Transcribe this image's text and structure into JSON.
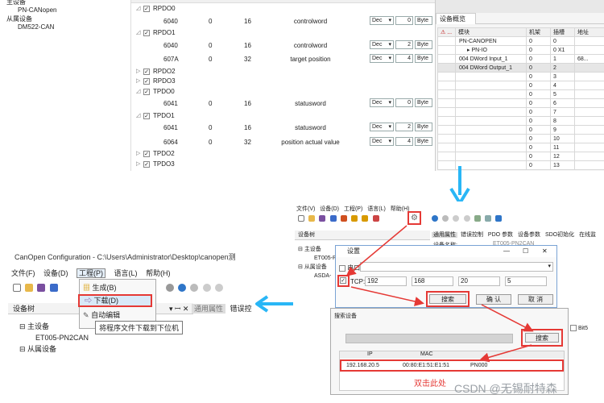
{
  "top_left_tree": {
    "items": [
      "主设备",
      "PN-CANopen",
      "从属设备",
      "DM522-CAN"
    ]
  },
  "pdo_panel": {
    "rows": [
      {
        "type": "group",
        "label": "RPDO0",
        "checked": true,
        "expand": "▲"
      },
      {
        "type": "row",
        "index": "6040",
        "sub": "0",
        "bits": "16",
        "name": "controlword",
        "fmt": "Dec",
        "val": "0",
        "unit": "Byte"
      },
      {
        "type": "group",
        "label": "RPDO1",
        "checked": true,
        "expand": "▲"
      },
      {
        "type": "row",
        "index": "6040",
        "sub": "0",
        "bits": "16",
        "name": "controlword",
        "fmt": "Dec",
        "val": "2",
        "unit": "Byte"
      },
      {
        "type": "row",
        "index": "607A",
        "sub": "0",
        "bits": "32",
        "name": "target position",
        "fmt": "Dec",
        "val": "4",
        "unit": "Byte"
      },
      {
        "type": "group",
        "label": "RPDO2",
        "checked": true,
        "expand": "▷"
      },
      {
        "type": "group",
        "label": "RPDO3",
        "checked": true,
        "expand": "▷"
      },
      {
        "type": "group",
        "label": "TPDO0",
        "checked": true,
        "expand": "▲"
      },
      {
        "type": "row",
        "index": "6041",
        "sub": "0",
        "bits": "16",
        "name": "statusword",
        "fmt": "Dec",
        "val": "0",
        "unit": "Byte"
      },
      {
        "type": "group",
        "label": "TPDO1",
        "checked": true,
        "expand": "▲"
      },
      {
        "type": "row",
        "index": "6041",
        "sub": "0",
        "bits": "16",
        "name": "statusword",
        "fmt": "Dec",
        "val": "2",
        "unit": "Byte"
      },
      {
        "type": "row",
        "index": "6064",
        "sub": "0",
        "bits": "32",
        "name": "position actual value",
        "fmt": "Dec",
        "val": "4",
        "unit": "Byte"
      },
      {
        "type": "group",
        "label": "TPDO2",
        "checked": true,
        "expand": "▷"
      },
      {
        "type": "group",
        "label": "TPDO3",
        "checked": true,
        "expand": "▷"
      }
    ]
  },
  "overview": {
    "title": "设备概览",
    "headers": [
      "模块",
      "机架",
      "插槽",
      "地址"
    ],
    "rows": [
      {
        "module": "PN-CANOPEN",
        "rack": "0",
        "slot": "0",
        "addr": ""
      },
      {
        "module": "PN-IO",
        "rack": "0",
        "slot": "0 X1",
        "addr": ""
      },
      {
        "module": "004 DWord Input_1",
        "rack": "0",
        "slot": "1",
        "addr": "68..."
      },
      {
        "module": "004 DWord Output_1",
        "rack": "0",
        "slot": "2",
        "addr": ""
      },
      {
        "module": "",
        "rack": "0",
        "slot": "3",
        "addr": ""
      },
      {
        "module": "",
        "rack": "0",
        "slot": "4",
        "addr": ""
      },
      {
        "module": "",
        "rack": "0",
        "slot": "5",
        "addr": ""
      },
      {
        "module": "",
        "rack": "0",
        "slot": "6",
        "addr": ""
      },
      {
        "module": "",
        "rack": "0",
        "slot": "7",
        "addr": ""
      },
      {
        "module": "",
        "rack": "0",
        "slot": "8",
        "addr": ""
      },
      {
        "module": "",
        "rack": "0",
        "slot": "9",
        "addr": ""
      },
      {
        "module": "",
        "rack": "0",
        "slot": "10",
        "addr": ""
      },
      {
        "module": "",
        "rack": "0",
        "slot": "11",
        "addr": ""
      },
      {
        "module": "",
        "rack": "0",
        "slot": "12",
        "addr": ""
      },
      {
        "module": "",
        "rack": "0",
        "slot": "13",
        "addr": ""
      }
    ]
  },
  "left_window": {
    "title": "CanOpen Configuration - C:\\Users\\Administrator\\Desktop\\canopen测",
    "menu": [
      "文件(F)",
      "设备(D)",
      "工程(P)",
      "语言(L)",
      "帮助(H)"
    ],
    "dropdown": [
      "生成(B)",
      "下载(D)",
      "自动编辑"
    ],
    "tooltip": "将程序文件下载到下位机",
    "tree_title": "设备树",
    "tree": [
      "主设备",
      "ET005-PN2CAN",
      "从属设备"
    ],
    "tabs": [
      "通用属性",
      "错误控"
    ]
  },
  "right_window": {
    "menu": [
      "文件(V)",
      "设备(D)",
      "工程(P)",
      "语言(L)",
      "帮助(H)"
    ],
    "tree_title": "设备树",
    "tree": [
      "主设备",
      "ET005-P",
      "从属设备",
      "ASDA-"
    ],
    "tabs": [
      "通用属性",
      "错误控制",
      "PDO 参数",
      "设备参数",
      "SDO初始化",
      "在线监"
    ],
    "field_label": "设备名称:",
    "field_value": "ET005-PN2CAN",
    "bit5": "Bit5"
  },
  "settings_dialog": {
    "title": "设置",
    "serial_label": "串口",
    "tcp_label": "TCP:",
    "ip": [
      "192",
      "168",
      "20",
      "5"
    ],
    "buttons": [
      "搜索",
      "确 认",
      "取 消"
    ]
  },
  "search_dialog": {
    "title": "搜索设备",
    "button": "搜索",
    "headers": [
      "IP",
      "MAC",
      ""
    ],
    "row": {
      "ip": "192.168.20.5",
      "mac": "00:80:E1:51:E1:51",
      "name": "PN000"
    },
    "hint": "双击此处"
  },
  "watermark": "CSDN @无锡耐特森",
  "colors": {
    "red": "#e53935",
    "cyan": "#29b6f6"
  }
}
